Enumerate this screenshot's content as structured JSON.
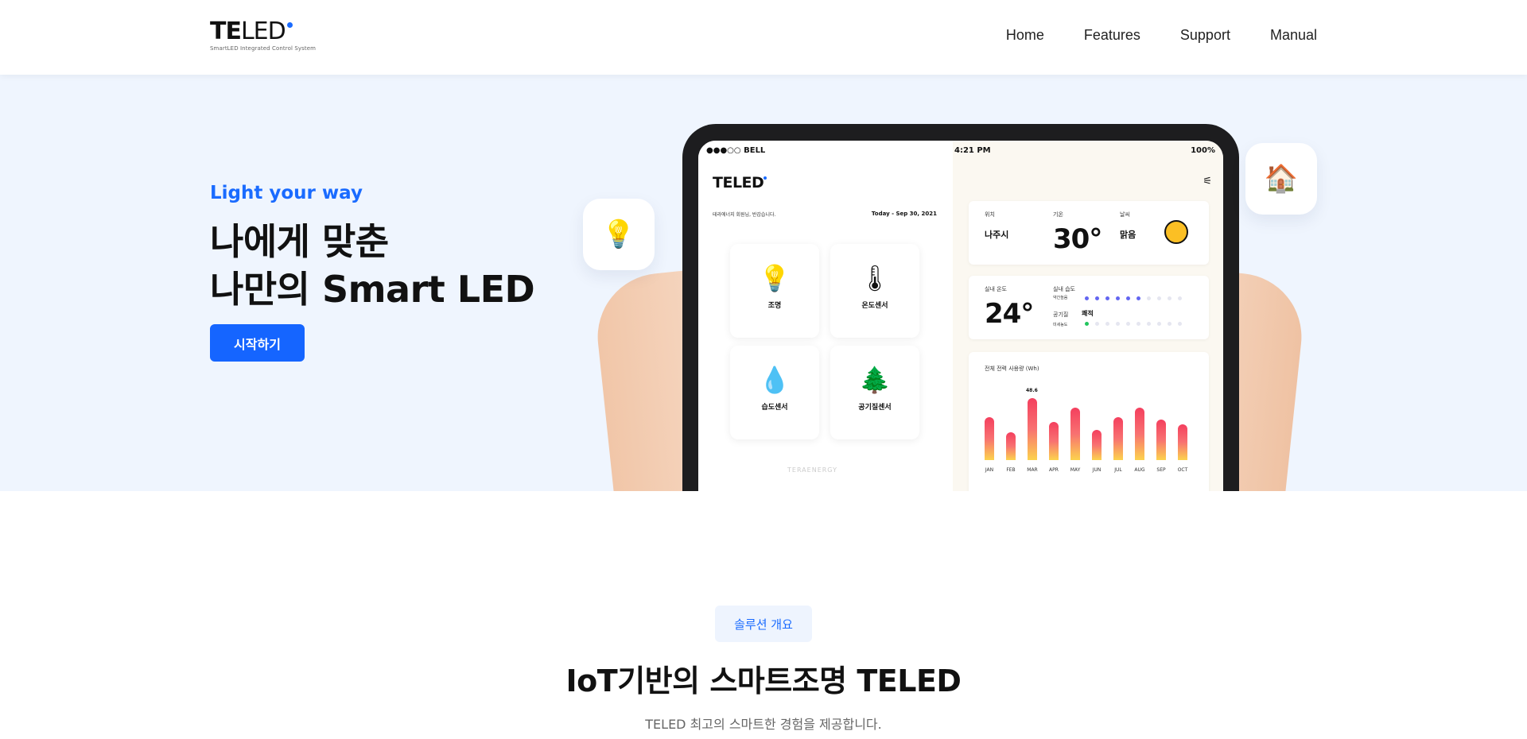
{
  "brand": {
    "name_bold": "TE",
    "name_light": "LED",
    "subtitle": "SmartLED Integrated Control System",
    "accent": "#1a6bff"
  },
  "nav": {
    "items": [
      "Home",
      "Features",
      "Support",
      "Manual"
    ]
  },
  "hero": {
    "tagline": "Light your way",
    "headline_line1": "나에게 맞춘",
    "headline_line2": "나만의 Smart LED",
    "cta_label": "시작하기",
    "background": "#eff5fe",
    "tablet": {
      "status_left": "●●●○○ BELL",
      "status_time": "4:21 PM",
      "status_right": "100%",
      "logo": "TELED",
      "greeting": "테라에너지 회원님, 반갑습니다.",
      "date": "Today - Sep 30, 2021",
      "tiles": [
        "조명",
        "온도센서",
        "습도센서",
        "공기질센서"
      ],
      "footer_logo": "TERAENERGY",
      "weather": {
        "loc_label": "위치",
        "loc_value": "나주시",
        "temp_label": "기온",
        "temp_value": "30°",
        "sky_label": "날씨",
        "sky_value": "맑음"
      },
      "indoor": {
        "temp_label": "실내 온도",
        "temp_value": "24°",
        "humid_label": "실내 습도",
        "humid_sub": "약간높음",
        "air_label": "공기질",
        "air_value": "쾌적",
        "air_sub": "미세농도"
      },
      "usage": {
        "title": "전체 전력 사용량 (Wh)",
        "peak_label": "48.6"
      }
    }
  },
  "chart_data": {
    "type": "bar",
    "categories": [
      "JAN",
      "FEB",
      "MAR",
      "APR",
      "MAY",
      "JUN",
      "JUL",
      "AUG",
      "SEP",
      "OCT"
    ],
    "values": [
      34,
      22,
      48.6,
      30,
      41,
      24,
      34,
      41,
      32,
      28
    ],
    "ylim": [
      0,
      50
    ]
  },
  "section": {
    "pill": "솔루션 개요",
    "title": "IoT기반의 스마트조명 TELED",
    "subtitle": "TELED 최고의 스마트한 경험을 제공합니다."
  }
}
